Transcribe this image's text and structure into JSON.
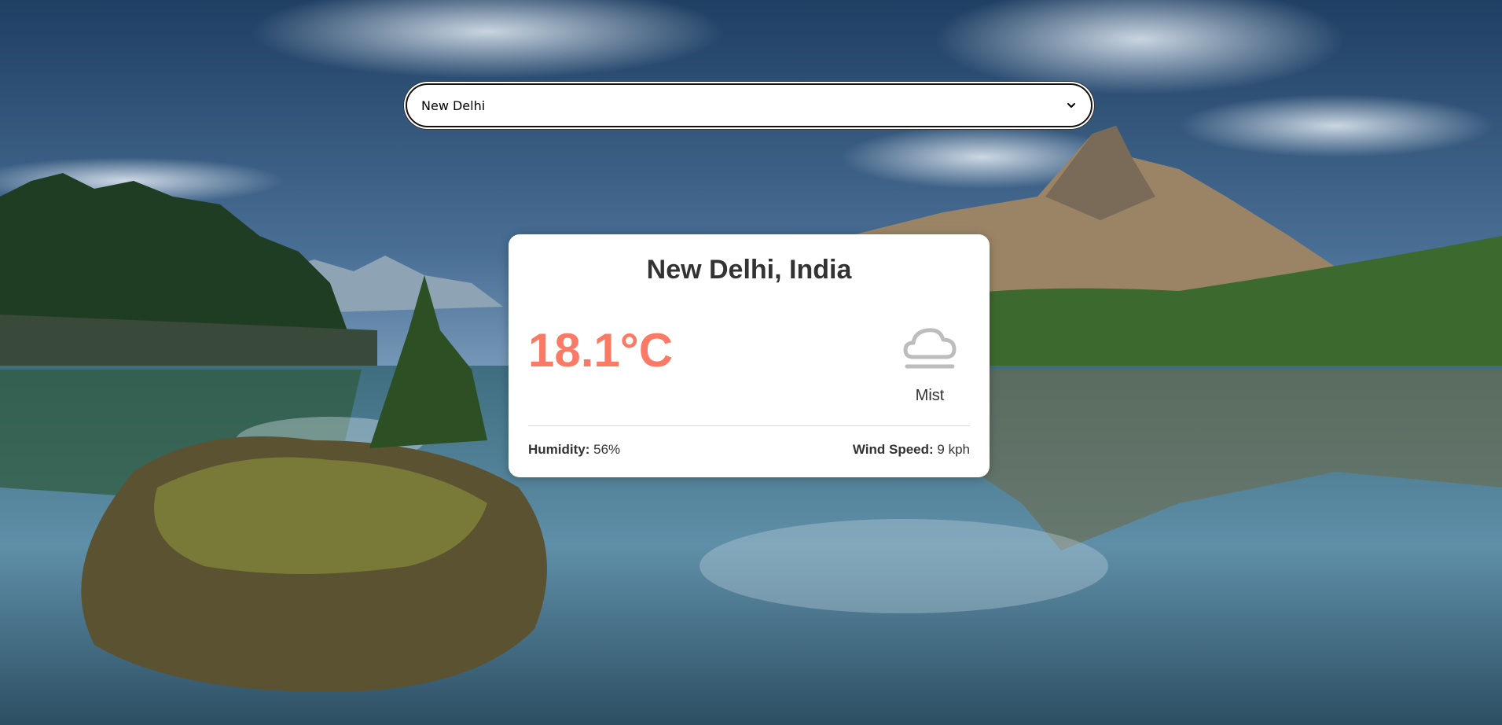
{
  "search": {
    "selected_city": "New Delhi"
  },
  "weather": {
    "location": "New Delhi, India",
    "temperature": "18.1°C",
    "condition": "Mist",
    "condition_icon": "mist-cloud-icon",
    "humidity_label": "Humidity:",
    "humidity_value": "56%",
    "wind_label": "Wind Speed:",
    "wind_value": "9 kph"
  },
  "colors": {
    "temperature": "#fa7a65",
    "text": "#333333",
    "card_background": "#ffffff"
  }
}
